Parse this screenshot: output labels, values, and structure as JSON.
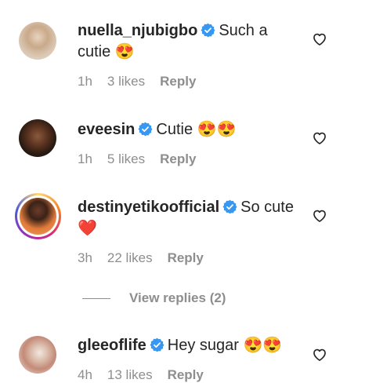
{
  "comments": [
    {
      "username": "nuella_njubigbo",
      "text": "Such a cutie",
      "emoji": "😍",
      "time": "1h",
      "likes": "3 likes",
      "reply": "Reply"
    },
    {
      "username": "eveesin",
      "text": "Cutie",
      "emoji": "😍😍",
      "time": "1h",
      "likes": "5 likes",
      "reply": "Reply"
    },
    {
      "username": "destinyetikoofficial",
      "text": "So cute",
      "emoji": "❤️",
      "time": "3h",
      "likes": "22 likes",
      "reply": "Reply"
    },
    {
      "username": "gleeoflife",
      "text": "Hey sugar",
      "emoji": "😍😍",
      "time": "4h",
      "likes": "13 likes",
      "reply": "Reply"
    }
  ],
  "view_replies": "View replies (2)",
  "colors": {
    "verified": "#3897f0",
    "muted": "#8e8e8e",
    "text": "#262626"
  },
  "icons": {
    "verified": "verified-badge-icon",
    "like": "heart-outline-icon"
  }
}
